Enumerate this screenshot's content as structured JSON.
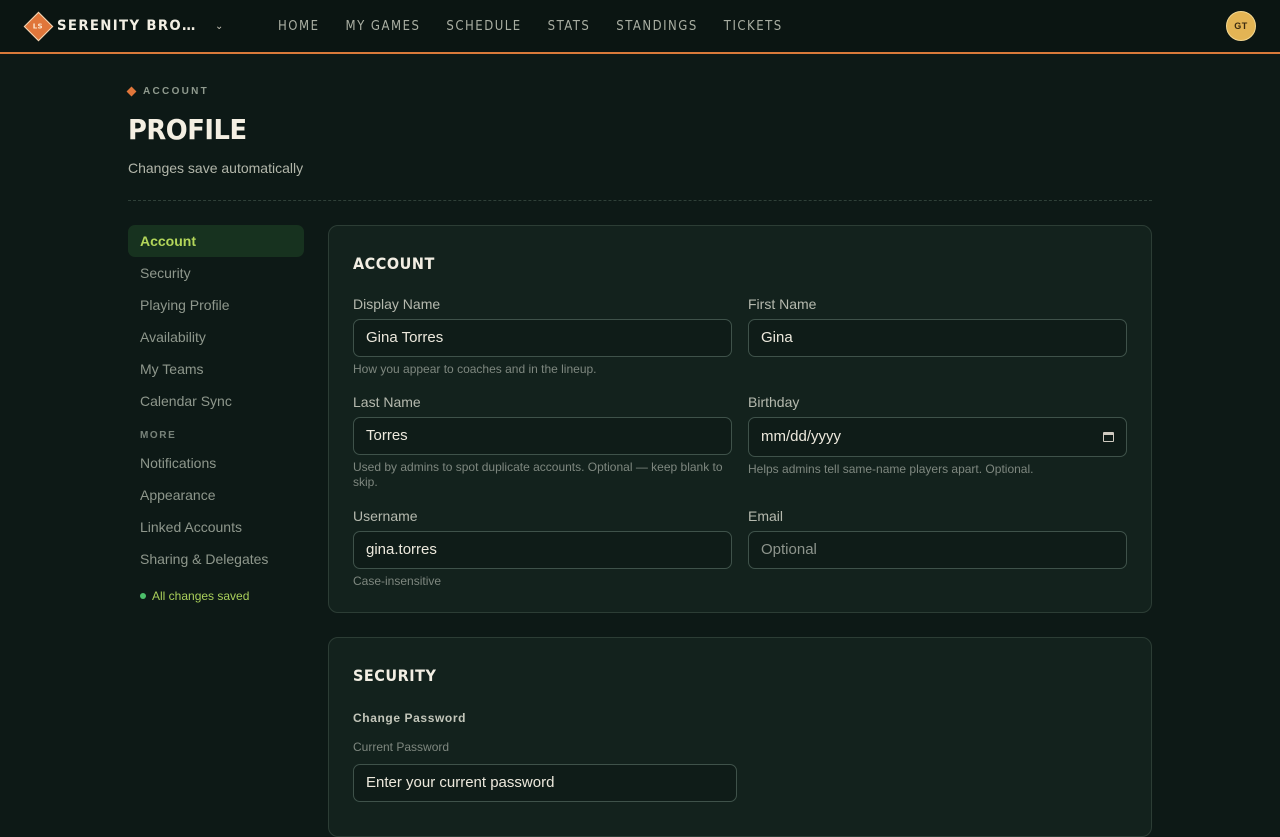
{
  "brand": {
    "initials": "LS",
    "name": "SERENITY BROWNCOATS"
  },
  "nav": [
    "HOME",
    "MY GAMES",
    "SCHEDULE",
    "STATS",
    "STANDINGS",
    "TICKETS"
  ],
  "user": {
    "initials": "GT"
  },
  "header": {
    "eyebrow": "ACCOUNT",
    "title": "PROFILE",
    "subtitle": "Changes save automatically"
  },
  "sidenav": {
    "items": [
      "Account",
      "Security",
      "Playing Profile",
      "Availability",
      "My Teams",
      "Calendar Sync"
    ],
    "more_label": "MORE",
    "more_items": [
      "Notifications",
      "Appearance",
      "Linked Accounts",
      "Sharing & Delegates"
    ],
    "status": "All changes saved"
  },
  "account": {
    "title": "ACCOUNT",
    "display_name": {
      "label": "Display Name",
      "value": "Gina Torres",
      "help": "How you appear to coaches and in the lineup."
    },
    "first_name": {
      "label": "First Name",
      "value": "Gina"
    },
    "last_name": {
      "label": "Last Name",
      "value": "Torres",
      "help": "Used by admins to spot duplicate accounts. Optional — keep blank to skip."
    },
    "birthday": {
      "label": "Birthday",
      "placeholder": "mm/dd/yyyy",
      "help": "Helps admins tell same-name players apart. Optional."
    },
    "username": {
      "label": "Username",
      "value": "gina.torres",
      "help": "Case-insensitive"
    },
    "email": {
      "label": "Email",
      "placeholder": "Optional"
    }
  },
  "security": {
    "title": "SECURITY",
    "subhead": "Change Password",
    "current_label": "Current Password",
    "current_placeholder": "Enter your current password"
  },
  "colors": {
    "accent": "#d97a3a",
    "active_nav": "#b3d65a",
    "saved": "#4cbf6a",
    "avatar": "#e3b454"
  }
}
